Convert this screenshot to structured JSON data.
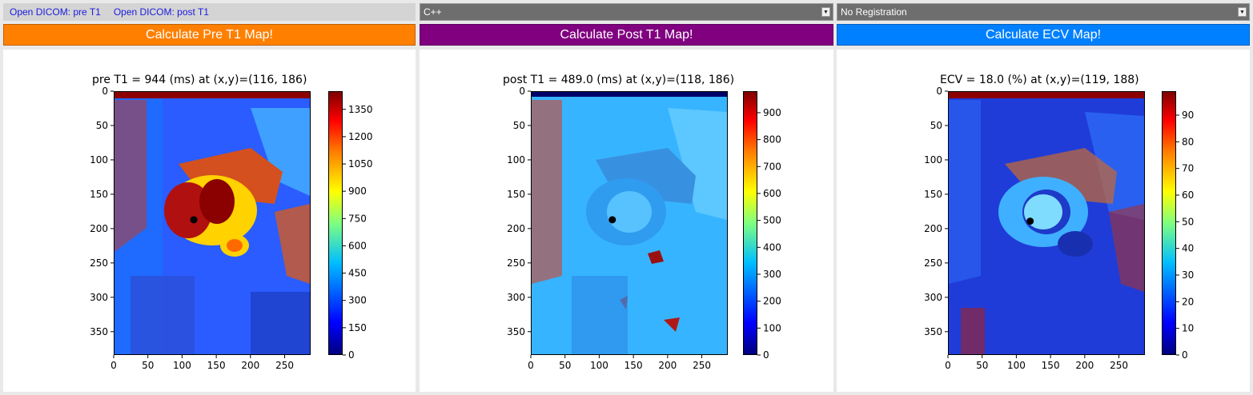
{
  "toolbar": {
    "open_pre": "Open DICOM: pre T1",
    "open_post": "Open DICOM: post T1",
    "language_select": "C++",
    "registration_select": "No Registration"
  },
  "buttons": {
    "pre": {
      "label": "Calculate Pre T1 Map!",
      "color": "#ff8000"
    },
    "post": {
      "label": "Calculate Post T1 Map!",
      "color": "#800080"
    },
    "ecv": {
      "label": "Calculate ECV Map!",
      "color": "#0080ff"
    }
  },
  "plots": [
    {
      "title": "pre T1 = 944 (ms) at (x,y)=(116, 186)",
      "marker": {
        "x": 116,
        "y": 186
      },
      "x_ticks": [
        "0",
        "50",
        "100",
        "150",
        "200",
        "250"
      ],
      "y_ticks": [
        "0",
        "50",
        "100",
        "150",
        "200",
        "250",
        "300",
        "350"
      ],
      "cbar_ticks": [
        "0",
        "150",
        "300",
        "450",
        "600",
        "750",
        "900",
        "1050",
        "1200",
        "1350"
      ],
      "cbar_range": [
        0,
        1450
      ]
    },
    {
      "title": "post T1 = 489.0 (ms) at (x,y)=(118, 186)",
      "marker": {
        "x": 118,
        "y": 186
      },
      "x_ticks": [
        "0",
        "50",
        "100",
        "150",
        "200",
        "250"
      ],
      "y_ticks": [
        "0",
        "50",
        "100",
        "150",
        "200",
        "250",
        "300",
        "350"
      ],
      "cbar_ticks": [
        "0",
        "100",
        "200",
        "300",
        "400",
        "500",
        "600",
        "700",
        "800",
        "900"
      ],
      "cbar_range": [
        0,
        980
      ]
    },
    {
      "title": "ECV = 18.0 (%) at (x,y)=(119, 188)",
      "marker": {
        "x": 119,
        "y": 188
      },
      "x_ticks": [
        "0",
        "50",
        "100",
        "150",
        "200",
        "250"
      ],
      "y_ticks": [
        "0",
        "50",
        "100",
        "150",
        "200",
        "250",
        "300",
        "350"
      ],
      "cbar_ticks": [
        "0",
        "10",
        "20",
        "30",
        "40",
        "50",
        "60",
        "70",
        "80",
        "90"
      ],
      "cbar_range": [
        0,
        99
      ]
    }
  ],
  "image_extent": {
    "x": [
      0,
      288
    ],
    "y": [
      0,
      384
    ]
  },
  "colormap": "jet"
}
